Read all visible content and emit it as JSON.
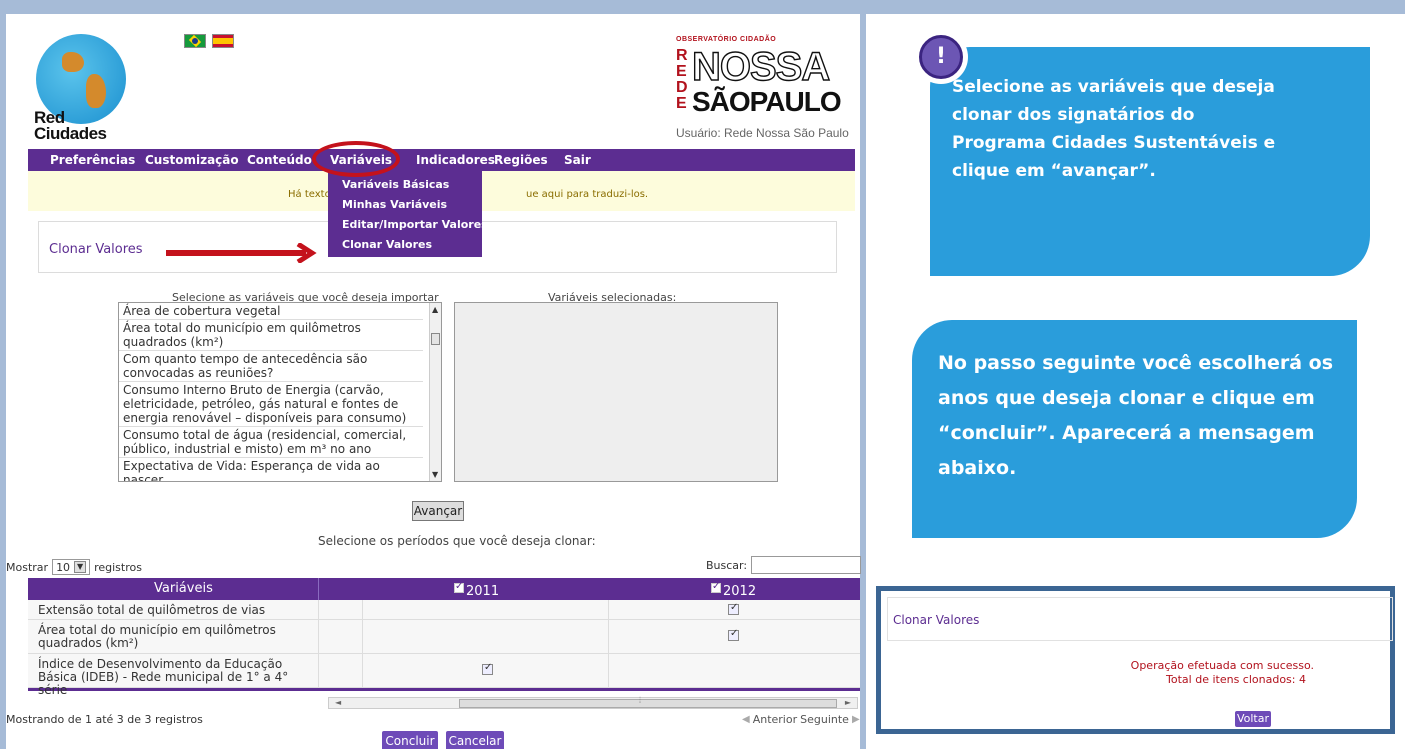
{
  "logo": {
    "red_cidades_line1": "Red",
    "red_cidades_line2": "Ciudades"
  },
  "observatorio": {
    "line1": "OBSERVATÓRIO CIDADÃO",
    "rede_letters": [
      "R",
      "E",
      "D",
      "E"
    ],
    "nossa": "NOSSA",
    "sao_paulo": "SÃOPAULO",
    "user": "Usuário: Rede Nossa São Paulo"
  },
  "menu": {
    "items": [
      "Preferências",
      "Customização",
      "Conteúdo",
      "Variáveis",
      "Indicadores",
      "Regiões",
      "Sair"
    ]
  },
  "notice": {
    "left": "Há textos",
    "right": "ue aqui para traduzi-los."
  },
  "dropdown": {
    "items": [
      "Variáveis Básicas",
      "Minhas Variáveis",
      "Editar/Importar Valores",
      "Clonar Valores"
    ]
  },
  "clone_box": {
    "title": "Clonar Valores"
  },
  "selector": {
    "left_label": "Selecione as variáveis que você deseja importar",
    "right_label": "Variáveis selecionadas:",
    "options": [
      "Área de cobertura vegetal",
      "Área total do município em quilômetros quadrados (km²)",
      "Com quanto tempo de antecedência são convocadas as reuniões?",
      "Consumo Interno Bruto de Energia (carvão, eletricidade, petróleo, gás natural e fontes de energia renovável – disponíveis para consumo)",
      "Consumo total de água (residencial, comercial, público, industrial e misto) em m³ no ano",
      "Expectativa de Vida: Esperança de vida ao nascer"
    ]
  },
  "avancar_label": "Avançar",
  "periodos_label": "Selecione os períodos que você deseja clonar:",
  "table_controls": {
    "mostrar": "Mostrar",
    "page_size": "10",
    "registros": "registros",
    "buscar": "Buscar:"
  },
  "table": {
    "headers": {
      "variaveis": "Variáveis",
      "y2011": "2011",
      "y2012": "2012"
    },
    "rows": [
      {
        "name": "Extensão total de quilômetros de vias",
        "y2011": false,
        "y2012": true
      },
      {
        "name": "Área total do município em quilômetros quadrados (km²)",
        "y2011": false,
        "y2012": true
      },
      {
        "name": "Índice de Desenvolvimento da Educação Básica (IDEB) - Rede municipal de 1° a 4° série",
        "y2011": true,
        "y2012": false
      }
    ]
  },
  "footer": {
    "info": "Mostrando de 1 até 3 de 3 registros",
    "anterior": "Anterior",
    "seguinte": "Seguinte",
    "concluir": "Concluir",
    "cancelar": "Cancelar"
  },
  "callout1": {
    "icon": "exclamation",
    "text": "Selecione as variáveis que deseja clonar dos signatários do Programa Cidades Sustentáveis e clique em “avançar”."
  },
  "callout2": {
    "text": "No passo seguinte você escolherá os anos que deseja clonar e clique em “concluir”. Aparecerá a mensagem abaixo."
  },
  "result": {
    "title": "Clonar Valores",
    "msg1": "Operação efetuada com sucesso.",
    "msg2": "Total de itens clonados: 4",
    "voltar": "Voltar"
  },
  "colors": {
    "purple": "#5c2d91",
    "callout": "#2a9ddb",
    "red": "#c4121c"
  }
}
